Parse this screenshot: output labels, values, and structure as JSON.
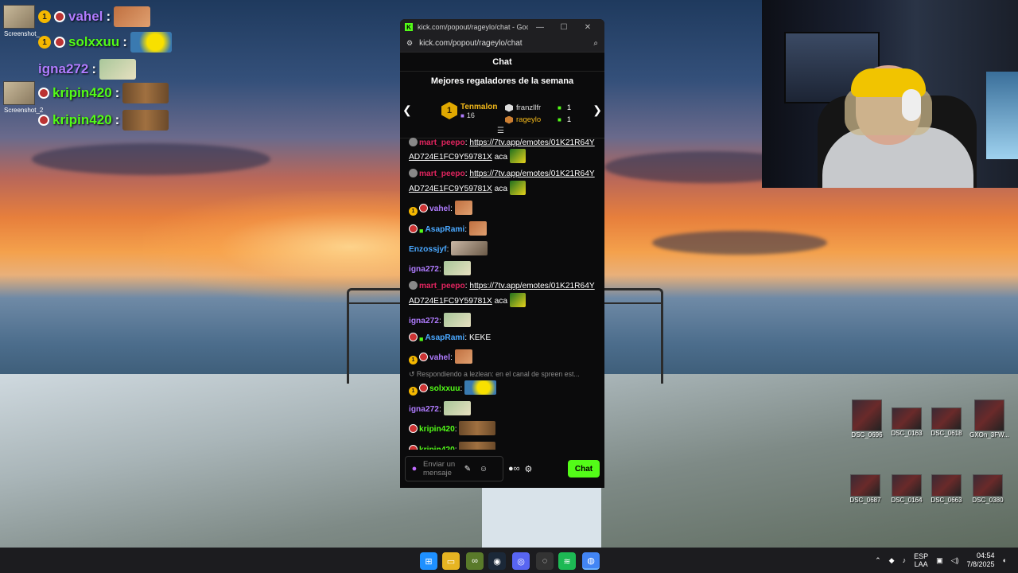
{
  "overlay": {
    "rows": [
      {
        "name": "vahel",
        "color": "#b07cff",
        "has_cam": true,
        "cam_label": "Screenshot_",
        "badges": [
          "1",
          "skull"
        ]
      },
      {
        "name": "solxxuu",
        "color": "#53fc18",
        "has_cam": false,
        "cam_label": "",
        "badges": [
          "1",
          "skull"
        ]
      },
      {
        "name": "igna272",
        "color": "#b07cff",
        "has_cam": false,
        "cam_label": "",
        "badges": []
      },
      {
        "name": "kripin420",
        "color": "#53fc18",
        "has_cam": true,
        "cam_label": "Screenshot_2",
        "badges": [
          "skull"
        ]
      },
      {
        "name": "kripin420",
        "color": "#53fc18",
        "has_cam": false,
        "cam_label": "",
        "badges": [
          "skull"
        ]
      }
    ]
  },
  "window": {
    "title": "kick.com/popout/rageylo/chat - Google...",
    "url": "kick.com/popout/rageylo/chat",
    "minimize": "—",
    "maximize": "☐",
    "close": "✕"
  },
  "chat": {
    "header": "Chat",
    "gifters_title": "Mejores regaladores de la semana",
    "top_gifter": {
      "rank": "1",
      "name": "Tenmalon",
      "count": "16"
    },
    "others": [
      {
        "name": "franzllfr",
        "count": "1"
      },
      {
        "name": "rageylo",
        "count": "1"
      }
    ],
    "messages": [
      {
        "user": "mart_peepo",
        "color": "#e0245e",
        "text": "https://7tv.app/emotes/01K21R64YAD724E1FC9Y59781X",
        "after": "aca"
      },
      {
        "user": "mart_peepo",
        "color": "#e0245e",
        "text": "https://7tv.app/emotes/01K21R64YAD724E1FC9Y59781X",
        "after": "aca"
      },
      {
        "user": "vahel",
        "color": "#b07cff",
        "text": "",
        "after": ""
      },
      {
        "user": "AsapRami",
        "color": "#4aa8ff",
        "text": "",
        "after": ""
      },
      {
        "user": "Enzossjyf",
        "color": "#4aa8ff",
        "text": "",
        "after": ""
      },
      {
        "user": "igna272",
        "color": "#b07cff",
        "text": "",
        "after": ""
      },
      {
        "user": "mart_peepo",
        "color": "#e0245e",
        "text": "https://7tv.app/emotes/01K21R64YAD724E1FC9Y59781X",
        "after": "aca"
      },
      {
        "user": "igna272",
        "color": "#b07cff",
        "text": "",
        "after": ""
      },
      {
        "user": "AsapRami",
        "color": "#4aa8ff",
        "text": "KEKE",
        "after": ""
      },
      {
        "user": "vahel",
        "color": "#b07cff",
        "text": "",
        "after": ""
      },
      {
        "user": "solxxuu",
        "color": "#53fc18",
        "text": "",
        "after": "",
        "reply": "Respondiendo a lezlean: en el canal de spreen est..."
      },
      {
        "user": "igna272",
        "color": "#b07cff",
        "text": "",
        "after": ""
      },
      {
        "user": "kripin420",
        "color": "#53fc18",
        "text": "",
        "after": ""
      },
      {
        "user": "kripin420",
        "color": "#53fc18",
        "text": "",
        "after": ""
      }
    ],
    "input_placeholder": "Enviar un mensaje",
    "send_label": "Chat"
  },
  "desktop_icons": [
    "DSC_0696",
    "DSC_0163",
    "DSC_0618",
    "GXOn_3FW...",
    "DSC_0687",
    "DSC_0164",
    "DSC_0663",
    "DSC_0380"
  ],
  "taskbar": {
    "lang_top": "ESP",
    "lang_bottom": "LAA",
    "time": "04:54",
    "date": "7/8/2025"
  }
}
